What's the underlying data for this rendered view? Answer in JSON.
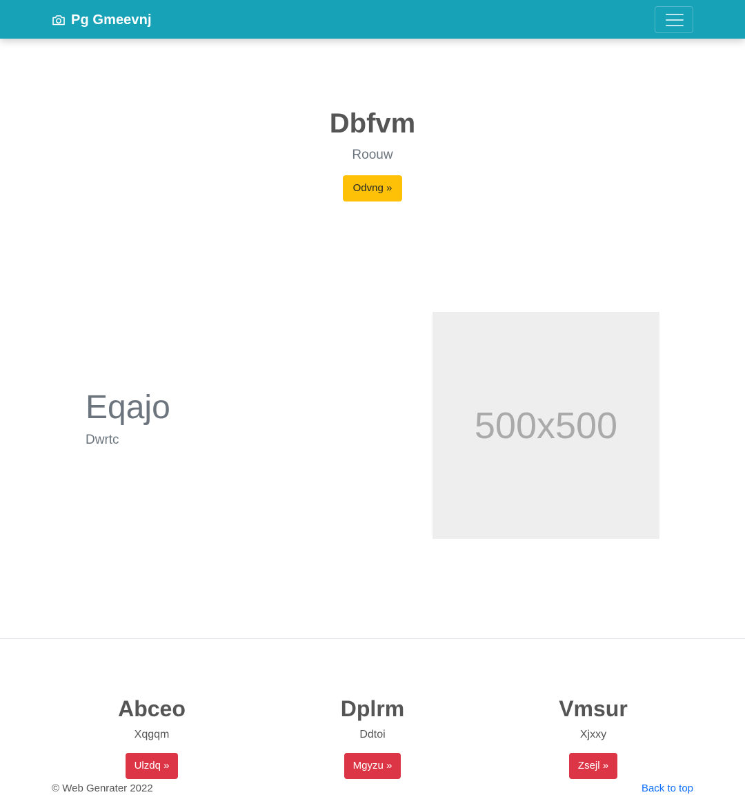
{
  "navbar": {
    "brand": "Pg Gmeevnj",
    "brand_icon": "camera-icon",
    "toggler_icon": "hamburger-menu-icon",
    "background_color": "#17a2b8"
  },
  "hero": {
    "title": "Dbfvm",
    "subtitle": "Roouw",
    "button_label": "Odvng »",
    "button_color": "#ffc107"
  },
  "feature": {
    "heading": "Eqajo",
    "subheading": "Dwrtc",
    "image_placeholder": "500x500"
  },
  "columns": [
    {
      "title": "Abceo",
      "text": "Xqgqm",
      "button_label": "Ulzdq »"
    },
    {
      "title": "Dplrm",
      "text": "Ddtoi",
      "button_label": "Mgyzu »"
    },
    {
      "title": "Vmsur",
      "text": "Xjxxy",
      "button_label": "Zsejl »"
    }
  ],
  "column_button_color": "#dc3545",
  "footer": {
    "copyright": "© Web Genrater 2022",
    "back_to_top": "Back to top",
    "link_color": "#0d6efd"
  }
}
